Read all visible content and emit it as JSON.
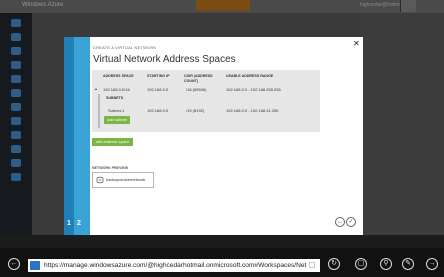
{
  "colors": {
    "accent_green": "#7bb542",
    "step_blue": "#3aa3d6",
    "step_blue_dark": "#1f7fb6",
    "table_bg": "#e6e6e6"
  },
  "portal": {
    "brand": "Windows Azure",
    "user": "highcedar@hotmail.com"
  },
  "wizard": {
    "breadcrumb": "CREATE A VIRTUAL NETWORK",
    "title": "Virtual Network Address Spaces",
    "close_icon": "close-icon",
    "table": {
      "headers": [
        "ADDRESS SPACE",
        "STARTING IP",
        "CIDR (ADDRESS COUNT)",
        "USABLE ADDRESS RANGE"
      ],
      "row": {
        "address_space": "192.168.0.0/16",
        "starting_ip": "192.168.0.0",
        "cidr": "/16 (65536)",
        "usable_range": "192.168.0.0 - 192.168.255.255"
      },
      "subnets_label": "SUBNETS",
      "subnet": {
        "name": "Subnet-1",
        "starting_ip": "192.168.0.0",
        "cidr": "/19 (8192)",
        "usable_range": "192.168.0.0 - 192.168.31.255"
      },
      "add_subnet_label": "add subnet"
    },
    "add_address_space_label": "add address space",
    "network_preview_label": "NETWORK PREVIEW",
    "preview_network_name": "hadoopclusternetwork",
    "steps": [
      "1",
      "2"
    ],
    "back_icon": "back-arrow-icon",
    "complete_icon": "checkmark-icon"
  },
  "browser": {
    "url": "https://manage.windowsazure.com/@highcedarhotmail.onmicrosoft.com#Workspaces/Net",
    "icons": [
      "back-icon",
      "windows-logo-icon",
      "lock-icon",
      "refresh-icon",
      "tabs-icon",
      "pin-icon",
      "tools-icon",
      "forward-icon"
    ]
  }
}
